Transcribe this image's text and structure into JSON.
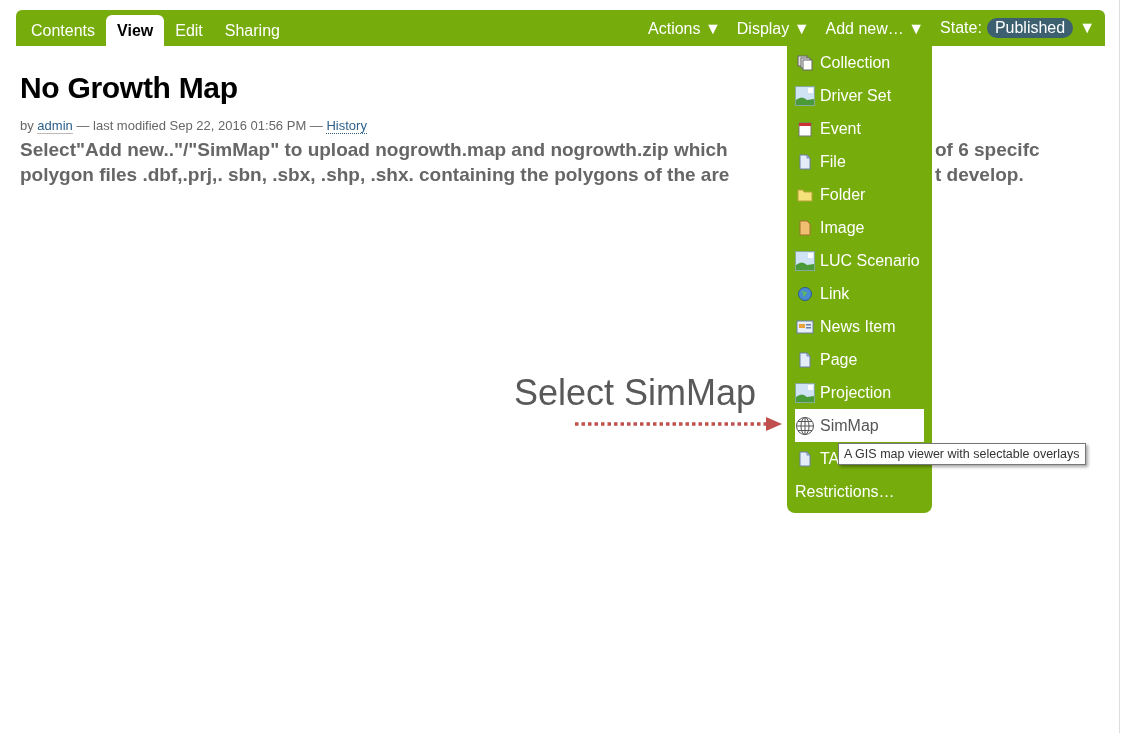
{
  "tabs": [
    {
      "label": "Contents",
      "selected": false
    },
    {
      "label": "View",
      "selected": true
    },
    {
      "label": "Edit",
      "selected": false
    },
    {
      "label": "Sharing",
      "selected": false
    }
  ],
  "actions": [
    {
      "label": "Actions",
      "caret": "▼"
    },
    {
      "label": "Display",
      "caret": "▼"
    },
    {
      "label": "Add new…",
      "caret": "▼"
    }
  ],
  "state": {
    "label": "State:",
    "value": "Published",
    "caret": "▼"
  },
  "page": {
    "title": "No Growth Map",
    "byline": {
      "by": "by",
      "author": "admin",
      "modified": "— last modified Sep 22, 2016 01:56 PM —",
      "history": "History"
    },
    "description_lines": [
      {
        "left": "Select\"Add new..\"/\"SimMap\" to upload nogrowth.map and nogrowth.zip which",
        "right": "of 6 specifc"
      },
      {
        "left": "polygon files .dbf,.prj,. sbn, .sbx, .shp, .shx. containing the polygons of the are",
        "right": "t develop."
      }
    ]
  },
  "add_menu": {
    "items": [
      {
        "label": "Collection",
        "kind": "collection",
        "selected": false
      },
      {
        "label": "Driver Set",
        "kind": "picture",
        "selected": false
      },
      {
        "label": "Event",
        "kind": "calendar",
        "selected": false
      },
      {
        "label": "File",
        "kind": "file",
        "selected": false
      },
      {
        "label": "Folder",
        "kind": "folder",
        "selected": false
      },
      {
        "label": "Image",
        "kind": "image",
        "selected": false
      },
      {
        "label": "LUC Scenario",
        "kind": "picture",
        "selected": false
      },
      {
        "label": "Link",
        "kind": "link",
        "selected": false
      },
      {
        "label": "News Item",
        "kind": "news",
        "selected": false
      },
      {
        "label": "Page",
        "kind": "file",
        "selected": false
      },
      {
        "label": "Projection",
        "kind": "picture",
        "selected": false
      },
      {
        "label": "SimMap",
        "kind": "globe",
        "selected": true
      },
      {
        "label": "TA",
        "kind": "file",
        "selected": false
      }
    ],
    "footer": "Restrictions…"
  },
  "tooltip": "A GIS map viewer with selectable overlays",
  "annotation": {
    "label": "Select SimMap"
  }
}
